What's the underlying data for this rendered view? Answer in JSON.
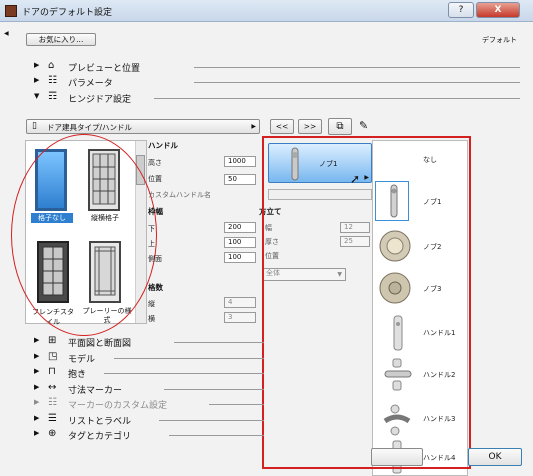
{
  "window": {
    "title": "ドアのデフォルト設定",
    "help": "?",
    "close": "X"
  },
  "toolbar": {
    "favorites": "お気に入り...",
    "top_right": "デフォルト"
  },
  "sections": {
    "preview": "プレビューと位置",
    "params": "パラメータ",
    "hinge": "ヒンジドア設定",
    "plan": "平面図と断面図",
    "model": "モデル",
    "reveal": "抱き",
    "dim": "寸法マーカー",
    "marker_custom": "マーカーのカスタム設定",
    "list": "リストとラベル",
    "tag": "タグとカテゴリ"
  },
  "gdl": {
    "dropdown": "ドア建具タイプ/ハンドル",
    "nav_prev": "<<",
    "nav_next": ">>"
  },
  "thumbnails": [
    {
      "label": "格子なし"
    },
    {
      "label": "縦横格子"
    },
    {
      "label": "フレンチスタイル"
    },
    {
      "label": "プレーリーの様式"
    }
  ],
  "handle": {
    "title": "ハンドル",
    "height_label": "高さ",
    "height": "1000",
    "position_label": "位置",
    "position": "50",
    "custom_label": "カスタムハンドル名"
  },
  "frame": {
    "title": "枠幅",
    "bottom_label": "下",
    "bottom": "200",
    "top_label": "上",
    "top": "100",
    "side_label": "側面",
    "side": "100"
  },
  "mullion": {
    "title": "格数",
    "vert_label": "縦",
    "vert": "4",
    "horiz_label": "横",
    "horiz": "3"
  },
  "selector": {
    "current": "ノブ1"
  },
  "frame2": {
    "title": "方立て",
    "width_label": "幅",
    "width": "12",
    "depth_label": "厚さ",
    "depth": "25",
    "pos_label": "位置",
    "pos_option": "全体"
  },
  "handle_list": [
    {
      "label": "なし"
    },
    {
      "label": "ノブ1"
    },
    {
      "label": "ノブ2"
    },
    {
      "label": "ノブ3"
    },
    {
      "label": "ハンドル1"
    },
    {
      "label": "ハンドル2"
    },
    {
      "label": "ハンドル3"
    },
    {
      "label": "ハンドル4"
    }
  ],
  "footer": {
    "ok": "OK"
  },
  "colors": {
    "highlight": "#d42020",
    "selection": "#3a8fd8"
  }
}
